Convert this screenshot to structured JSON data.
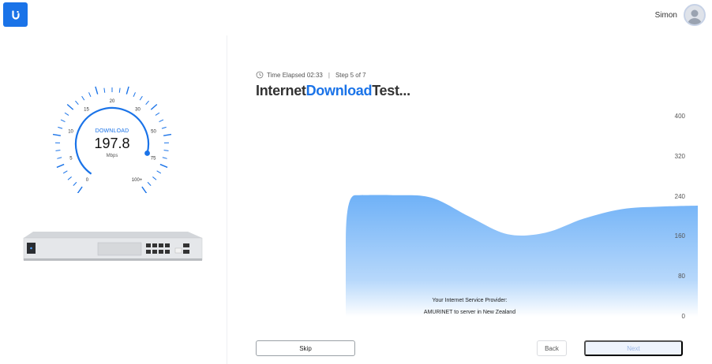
{
  "header": {
    "user_name": "Simon"
  },
  "gauge": {
    "label": "DOWNLOAD",
    "value": "197.8",
    "unit": "Mbps",
    "fraction": 0.86,
    "scale_labels": [
      "0",
      "5",
      "10",
      "15",
      "20",
      "30",
      "50",
      "75",
      "100+"
    ]
  },
  "status": {
    "time_elapsed": "Time Elapsed 02:33",
    "separator": "|",
    "step": "Step 5 of 7"
  },
  "title": {
    "part1": "Internet",
    "part2": "Download",
    "part3": "Test..."
  },
  "chart_data": {
    "type": "area",
    "y_ticks": [
      "400",
      "320",
      "240",
      "160",
      "80",
      "0"
    ],
    "ylim": [
      0,
      400
    ],
    "x": [
      0,
      1,
      2,
      3,
      4,
      5,
      6,
      7,
      8,
      9,
      10
    ],
    "values": [
      0,
      243,
      243,
      238,
      200,
      165,
      168,
      196,
      215,
      220,
      222
    ],
    "color": "#6fb1f7"
  },
  "isp": {
    "label": "Your Internet Service Provider:",
    "value": "AMURINET to server in New Zealand"
  },
  "buttons": {
    "skip": "Skip",
    "back": "Back",
    "next": "Next"
  },
  "colors": {
    "accent": "#1a73e8",
    "area_fill": "#6fb1f7"
  }
}
